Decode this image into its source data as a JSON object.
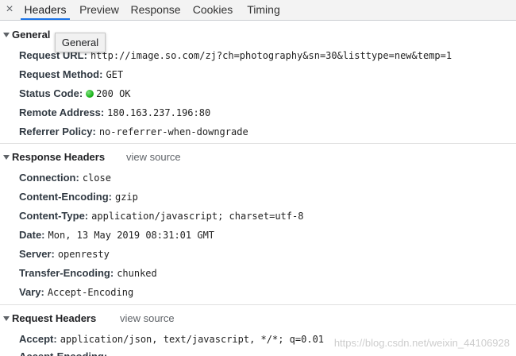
{
  "tabs": [
    {
      "label": "Headers",
      "active": true
    },
    {
      "label": "Preview",
      "active": false
    },
    {
      "label": "Response",
      "active": false
    },
    {
      "label": "Cookies",
      "active": false
    },
    {
      "label": "Timing",
      "active": false
    }
  ],
  "close_icon_glyph": "×",
  "general": {
    "title": "General",
    "tooltip": "General",
    "rows": [
      {
        "key": "Request URL:",
        "value": "http://image.so.com/zj?ch=photography&sn=30&listtype=new&temp=1"
      },
      {
        "key": "Request Method:",
        "value": "GET"
      },
      {
        "key": "Status Code:",
        "value": "200 OK",
        "status_color": "#1db41d"
      },
      {
        "key": "Remote Address:",
        "value": "180.163.237.196:80"
      },
      {
        "key": "Referrer Policy:",
        "value": "no-referrer-when-downgrade"
      }
    ]
  },
  "response_headers": {
    "title": "Response Headers",
    "view_source": "view source",
    "rows": [
      {
        "key": "Connection:",
        "value": "close"
      },
      {
        "key": "Content-Encoding:",
        "value": "gzip"
      },
      {
        "key": "Content-Type:",
        "value": "application/javascript; charset=utf-8"
      },
      {
        "key": "Date:",
        "value": "Mon, 13 May 2019 08:31:01 GMT"
      },
      {
        "key": "Server:",
        "value": "openresty"
      },
      {
        "key": "Transfer-Encoding:",
        "value": "chunked"
      },
      {
        "key": "Vary:",
        "value": "Accept-Encoding"
      }
    ]
  },
  "request_headers": {
    "title": "Request Headers",
    "view_source": "view source",
    "rows": [
      {
        "key": "Accept:",
        "value": "application/json, text/javascript, */*; q=0.01"
      },
      {
        "key": "Accept-Encoding:",
        "value": ""
      }
    ]
  },
  "watermark": "https://blog.csdn.net/weixin_44106928",
  "colors": {
    "active_tab_underline": "#1a73e8",
    "status_ok": "#1db41d"
  }
}
